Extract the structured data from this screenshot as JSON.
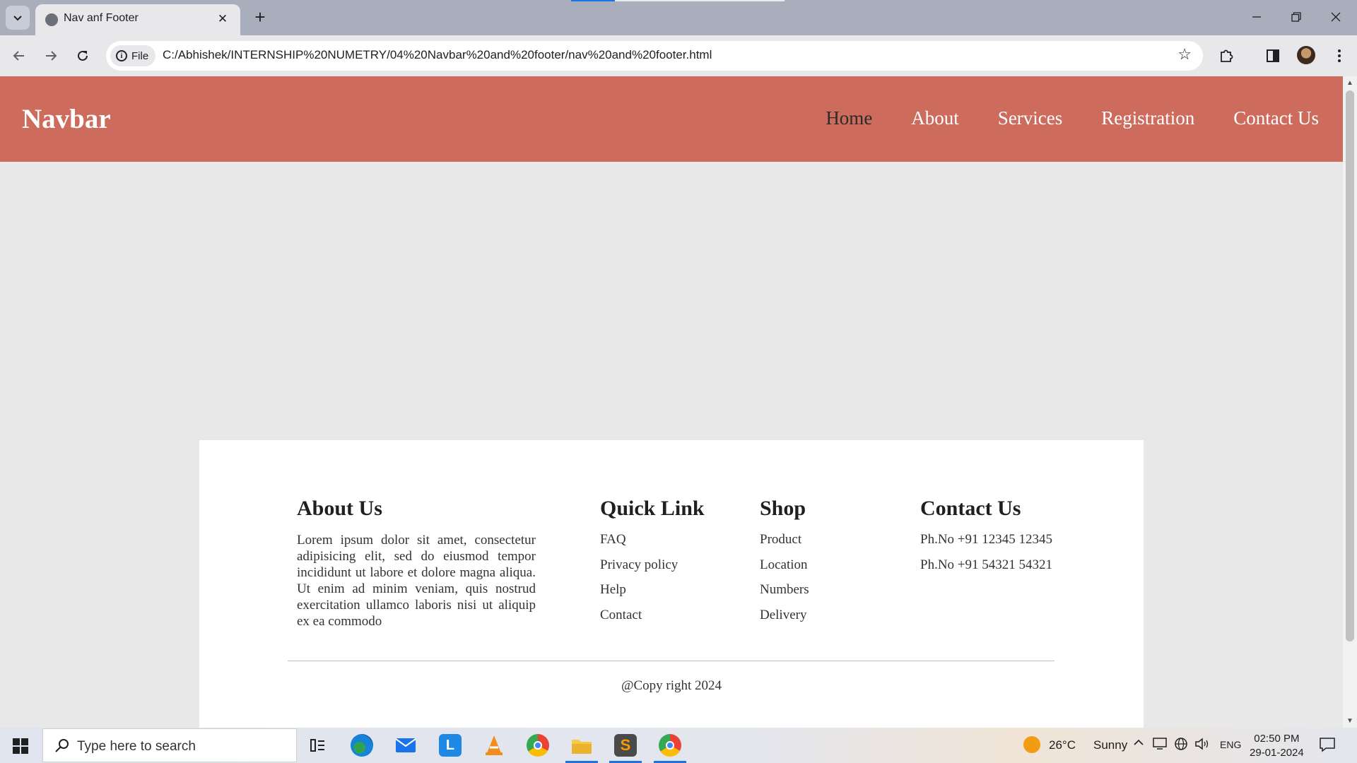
{
  "browser": {
    "tab_title": "Nav anf Footer",
    "new_tab_label": "+",
    "file_chip": "File",
    "url": "C:/Abhishek/INTERNSHIP%20NUMETRY/04%20Navbar%20and%20footer/nav%20and%20footer.html"
  },
  "page": {
    "brand": "Navbar",
    "nav": [
      "Home",
      "About",
      "Services",
      "Registration",
      "Contact Us"
    ],
    "footer": {
      "about": {
        "title": "About Us",
        "text": "Lorem ipsum dolor sit amet, consectetur adipisicing elit, sed do eiusmod tempor incididunt ut labore et dolore magna aliqua. Ut enim ad minim veniam, quis nostrud exercitation ullamco laboris nisi ut aliquip ex ea commodo"
      },
      "quick_link": {
        "title": "Quick Link",
        "items": [
          "FAQ",
          "Privacy policy",
          "Help",
          "Contact"
        ]
      },
      "shop": {
        "title": "Shop",
        "items": [
          "Product",
          "Location",
          "Numbers",
          "Delivery"
        ]
      },
      "contact": {
        "title": "Contact Us",
        "items": [
          "Ph.No +91 12345 12345",
          "Ph.No +91 54321 54321"
        ]
      },
      "copyright": "@Copy right 2024"
    }
  },
  "taskbar": {
    "search_placeholder": "Type here to search",
    "weather_temp": "26°C",
    "weather_text": "Sunny",
    "language": "ENG",
    "time": "02:50 PM",
    "date": "29-01-2024",
    "apps": [
      "task-view",
      "edge",
      "mail",
      "l-app",
      "vlc",
      "chrome",
      "file-explorer",
      "sublime-text",
      "chrome-profile"
    ]
  },
  "colors": {
    "navbar_bg": "#cd6b5d",
    "page_bg": "#e8e8e8",
    "active_nav": "#2b2b2b"
  }
}
